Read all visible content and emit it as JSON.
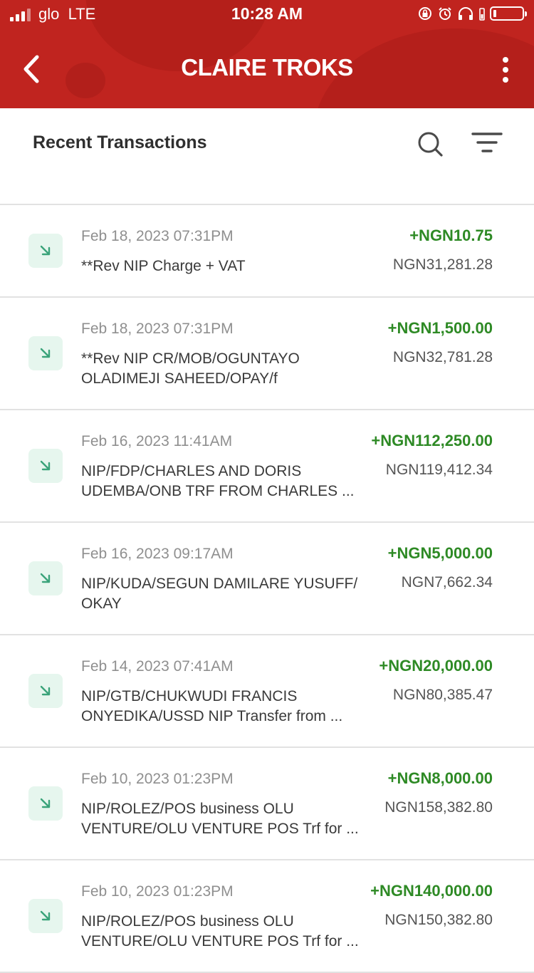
{
  "status_bar": {
    "carrier": "glo",
    "network": "LTE",
    "time": "10:28 AM",
    "signal_bars": 3,
    "battery_level": 0.1
  },
  "header": {
    "title": "CLAIRE TROKS",
    "back_icon": "chevron-left-icon",
    "menu_icon": "more-vertical-icon",
    "bg_color": "#c0241f"
  },
  "section": {
    "title": "Recent Transactions",
    "search_icon": "search-icon",
    "filter_icon": "filter-icon"
  },
  "colors": {
    "credit": "#2e8a25",
    "icon_bg": "#e6f6ee",
    "icon_arrow": "#3aa37a"
  },
  "transactions": [
    {
      "date": "Feb 18, 2023 07:31PM",
      "desc_line1": "**Rev NIP Charge + VAT",
      "desc_line2": "",
      "amount": "+NGN10.75",
      "balance": "NGN31,281.28"
    },
    {
      "date": "Feb 18, 2023 07:31PM",
      "desc_line1": "**Rev NIP CR/MOB/OGUNTAYO",
      "desc_line2": "OLADIMEJI SAHEED/OPAY/f",
      "amount": "+NGN1,500.00",
      "balance": "NGN32,781.28"
    },
    {
      "date": "Feb 16, 2023 11:41AM",
      "desc_line1": "NIP/FDP/CHARLES AND DORIS",
      "desc_line2": "UDEMBA/ONB TRF FROM CHARLES ...",
      "amount": "+NGN112,250.00",
      "balance": "NGN119,412.34"
    },
    {
      "date": "Feb 16, 2023 09:17AM",
      "desc_line1": "NIP/KUDA/SEGUN DAMILARE YUSUFF/",
      "desc_line2": "OKAY",
      "amount": "+NGN5,000.00",
      "balance": "NGN7,662.34"
    },
    {
      "date": "Feb 14, 2023 07:41AM",
      "desc_line1": "NIP/GTB/CHUKWUDI FRANCIS",
      "desc_line2": "ONYEDIKA/USSD NIP Transfer from ...",
      "amount": "+NGN20,000.00",
      "balance": "NGN80,385.47"
    },
    {
      "date": "Feb 10, 2023 01:23PM",
      "desc_line1": "NIP/ROLEZ/POS business OLU",
      "desc_line2": "VENTURE/OLU VENTURE POS Trf for ...",
      "amount": "+NGN8,000.00",
      "balance": "NGN158,382.80"
    },
    {
      "date": "Feb 10, 2023 01:23PM",
      "desc_line1": "NIP/ROLEZ/POS business OLU",
      "desc_line2": "VENTURE/OLU VENTURE POS Trf for ...",
      "amount": "+NGN140,000.00",
      "balance": "NGN150,382.80"
    }
  ]
}
